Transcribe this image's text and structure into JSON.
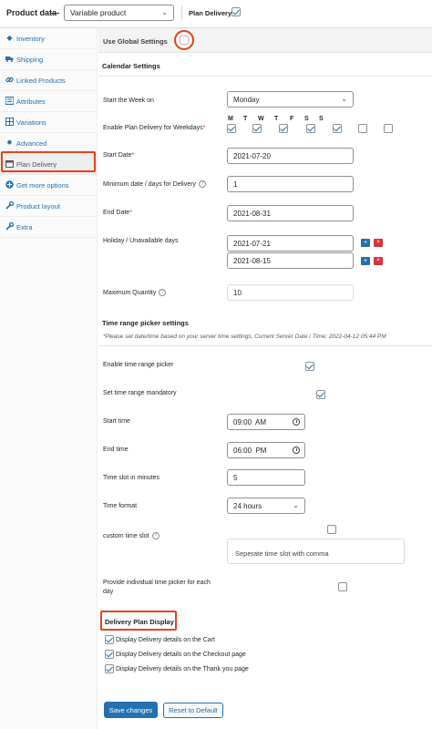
{
  "header": {
    "title": "Product data",
    "dash": "—",
    "product_type": "Variable product",
    "plan_delivery_label": "Plan Delivery:",
    "plan_delivery_checked": true
  },
  "sidebar": {
    "items": [
      {
        "label": "Inventory",
        "icon": "diamond-icon"
      },
      {
        "label": "Shipping",
        "icon": "truck-icon"
      },
      {
        "label": "Linked Products",
        "icon": "link-icon"
      },
      {
        "label": "Attributes",
        "icon": "list-icon"
      },
      {
        "label": "Variations",
        "icon": "grid-icon"
      },
      {
        "label": "Advanced",
        "icon": "gear-icon"
      },
      {
        "label": "Plan Delivery",
        "icon": "calendar-icon",
        "active": true
      },
      {
        "label": "Get more options",
        "icon": "plus-circle-icon"
      },
      {
        "label": "Product layout",
        "icon": "wrench-icon"
      },
      {
        "label": "Extra",
        "icon": "wrench-icon"
      }
    ]
  },
  "main": {
    "global": {
      "label": "Use Global Settings",
      "checked": false
    },
    "calendar_title": "Calendar Settings",
    "start_week": {
      "label": "Start the Week on",
      "value": "Monday"
    },
    "weekdays": {
      "label": "Enable Plan Delivery for Weekdays",
      "required": "*",
      "days": [
        {
          "letter": "M",
          "checked": true
        },
        {
          "letter": "T",
          "checked": true
        },
        {
          "letter": "W",
          "checked": true
        },
        {
          "letter": "T",
          "checked": true
        },
        {
          "letter": "F",
          "checked": true
        },
        {
          "letter": "S",
          "checked": false
        },
        {
          "letter": "S",
          "checked": false
        }
      ]
    },
    "start_date": {
      "label": "Start Date",
      "required": "*",
      "value": "2021-07-20"
    },
    "min_days": {
      "label": "Minimum date / days for Delivery",
      "help": "?",
      "value": "1"
    },
    "end_date": {
      "label": "End Date",
      "required": "*",
      "value": "2021-08-31"
    },
    "holiday": {
      "label": "Holiday / Unavailable days",
      "values": [
        "2021-07-21",
        "2021-08-15"
      ],
      "plus": "+",
      "remove": "×"
    },
    "max_qty": {
      "label": "Maximum Quantity",
      "help": "?",
      "value": "10"
    },
    "time_title": "Time range picker settings",
    "time_note": "*Please set date/time based on your server time settings, Current Server Date / Time; 2022-04-12 05:44 PM",
    "enable_time": {
      "label": "Enable time range picker",
      "checked": true
    },
    "time_mandatory": {
      "label": "Set time range mandatory",
      "checked": true
    },
    "start_time": {
      "label": "Start time",
      "value": "09:00  AM"
    },
    "end_time": {
      "label": "End time",
      "value": "06:00  PM"
    },
    "slot_minutes": {
      "label": "Time slot in minutes",
      "value": "5"
    },
    "time_format": {
      "label": "Time format",
      "value": "24 hours"
    },
    "custom_slot": {
      "label": "custom time slot",
      "help": "?",
      "checked": false,
      "placeholder": "Seperate time slot with comma"
    },
    "individual_picker": {
      "label_line1": "Provide individual time picker for each",
      "label_line2": "day",
      "checked": false
    },
    "display_title": "Delivery Plan Display",
    "display": [
      {
        "label": "Display Delivery details on the Cart",
        "checked": true
      },
      {
        "label": "Display Delivery details on the Checkout page",
        "checked": true
      },
      {
        "label": "Display Delivery details on the Thank you page",
        "checked": true
      }
    ],
    "save_label": "Save changes",
    "reset_label": "Reset to Default"
  },
  "colors": {
    "accent": "#2271b1",
    "highlight": "#e0451c",
    "danger": "#d63638"
  }
}
